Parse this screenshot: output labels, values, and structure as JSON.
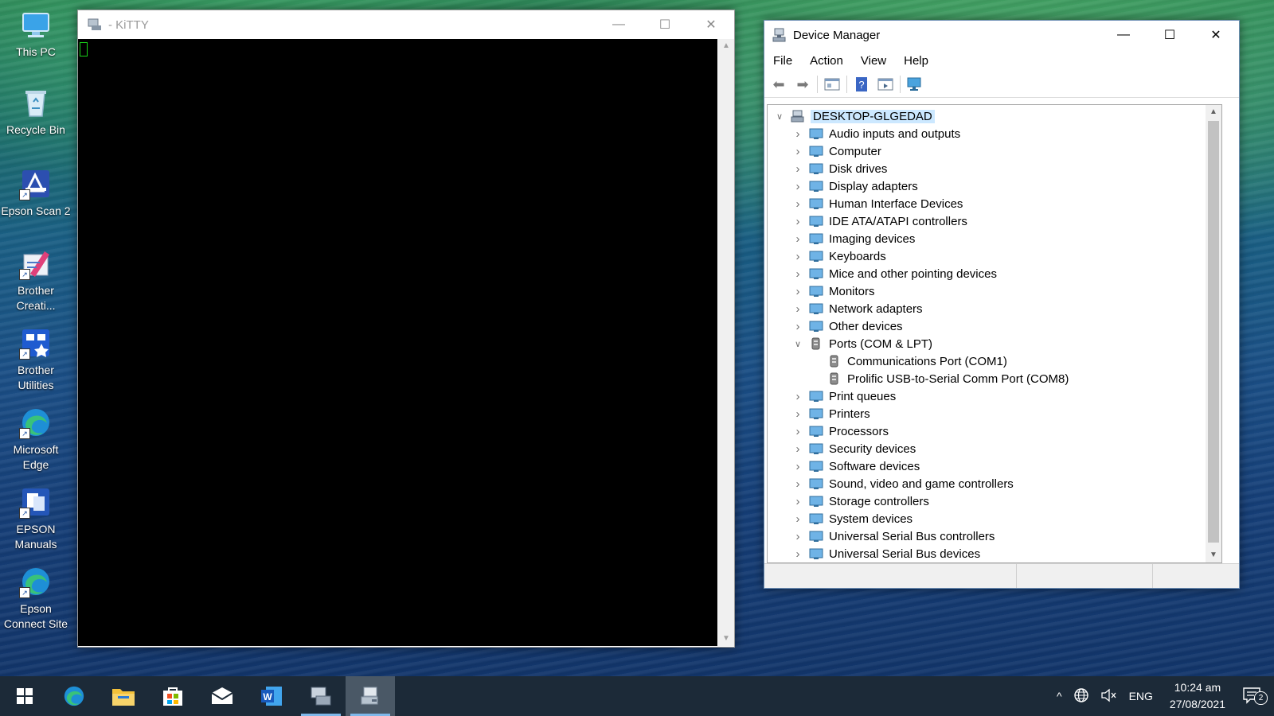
{
  "desktop": {
    "icons": [
      {
        "label": "This PC",
        "icon": "computer-icon"
      },
      {
        "label": "Recycle Bin",
        "icon": "recycle-bin-icon"
      },
      {
        "label": "Epson Scan 2",
        "icon": "scanner-icon"
      },
      {
        "label": "Brother\nCreati...",
        "icon": "brother-creative-icon"
      },
      {
        "label": "Brother\nUtilities",
        "icon": "brother-utilities-icon"
      },
      {
        "label": "Microsoft\nEdge",
        "icon": "edge-icon"
      },
      {
        "label": "EPSON\nManuals",
        "icon": "manuals-icon"
      },
      {
        "label": "Epson\nConnect Site",
        "icon": "edge-icon"
      }
    ]
  },
  "kitty": {
    "title": "- KiTTY",
    "controls": {
      "minimize": "—",
      "maximize": "☐",
      "close": "✕"
    }
  },
  "device_manager": {
    "title": "Device Manager",
    "controls": {
      "minimize": "—",
      "maximize": "☐",
      "close": "✕"
    },
    "menu": [
      "File",
      "Action",
      "View",
      "Help"
    ],
    "root": "DESKTOP-GLGEDAD",
    "categories": [
      {
        "label": "Audio inputs and outputs",
        "expanded": false
      },
      {
        "label": "Computer",
        "expanded": false
      },
      {
        "label": "Disk drives",
        "expanded": false
      },
      {
        "label": "Display adapters",
        "expanded": false
      },
      {
        "label": "Human Interface Devices",
        "expanded": false
      },
      {
        "label": "IDE ATA/ATAPI controllers",
        "expanded": false
      },
      {
        "label": "Imaging devices",
        "expanded": false
      },
      {
        "label": "Keyboards",
        "expanded": false
      },
      {
        "label": "Mice and other pointing devices",
        "expanded": false
      },
      {
        "label": "Monitors",
        "expanded": false
      },
      {
        "label": "Network adapters",
        "expanded": false
      },
      {
        "label": "Other devices",
        "expanded": false
      },
      {
        "label": "Ports (COM & LPT)",
        "expanded": true,
        "children": [
          "Communications Port (COM1)",
          "Prolific USB-to-Serial Comm Port (COM8)"
        ]
      },
      {
        "label": "Print queues",
        "expanded": false
      },
      {
        "label": "Printers",
        "expanded": false
      },
      {
        "label": "Processors",
        "expanded": false
      },
      {
        "label": "Security devices",
        "expanded": false
      },
      {
        "label": "Software devices",
        "expanded": false
      },
      {
        "label": "Sound, video and game controllers",
        "expanded": false
      },
      {
        "label": "Storage controllers",
        "expanded": false
      },
      {
        "label": "System devices",
        "expanded": false
      },
      {
        "label": "Universal Serial Bus controllers",
        "expanded": false
      },
      {
        "label": "Universal Serial Bus devices",
        "expanded": false
      }
    ]
  },
  "taskbar": {
    "apps": [
      "start-icon",
      "edge-icon",
      "file-explorer-icon",
      "store-icon",
      "mail-icon",
      "word-icon",
      "kitty-icon",
      "device-manager-icon"
    ],
    "tray": {
      "chevron": "^",
      "language": "ENG",
      "time": "10:24 am",
      "date": "27/08/2021",
      "notifications": "2"
    }
  },
  "colors": {
    "taskbar_bg": "#1c2a38",
    "terminal_bg": "#000000",
    "cursor": "#19d219",
    "tree_selection": "#cce8ff"
  }
}
